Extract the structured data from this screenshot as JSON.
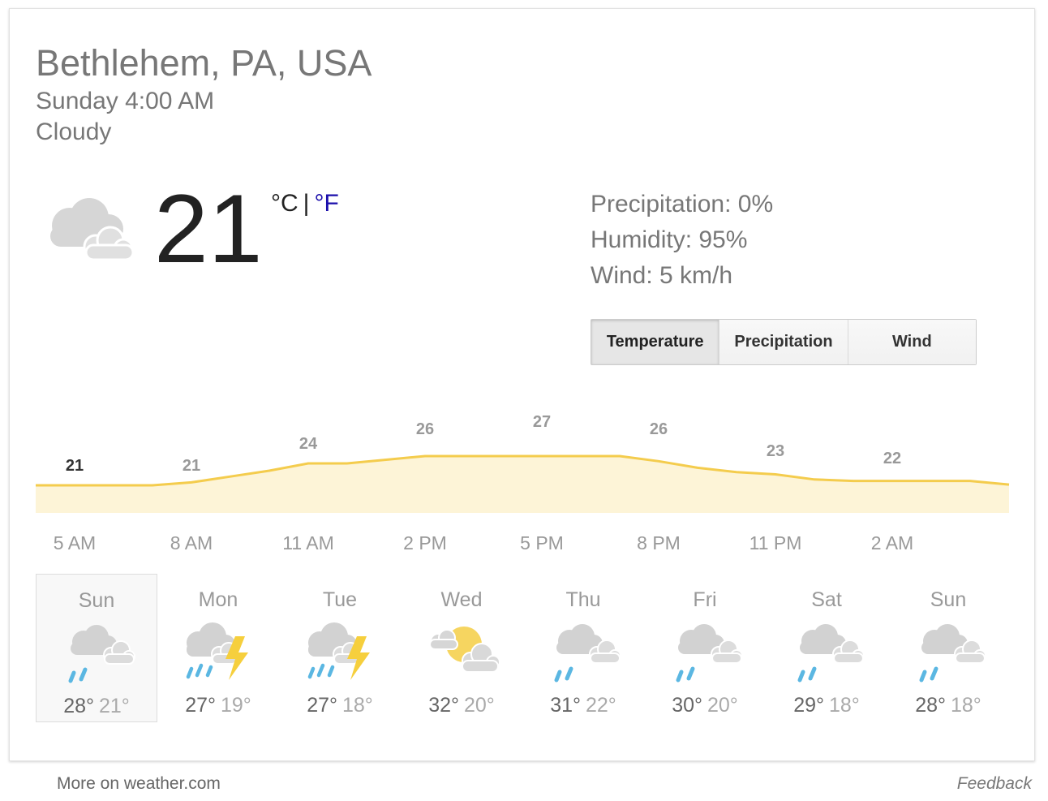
{
  "location": "Bethlehem, PA, USA",
  "datetime": "Sunday 4:00 AM",
  "condition": "Cloudy",
  "current": {
    "temperature": "21",
    "unit_c": "°C",
    "unit_sep": "|",
    "unit_f": "°F",
    "icon": "cloudy-icon"
  },
  "details": {
    "precipitation": "Precipitation: 0%",
    "humidity": "Humidity: 95%",
    "wind": "Wind: 5 km/h"
  },
  "tabs": [
    {
      "label": "Temperature",
      "active": true
    },
    {
      "label": "Precipitation",
      "active": false
    },
    {
      "label": "Wind",
      "active": false
    }
  ],
  "chart_data": {
    "type": "area",
    "x": [
      "5 AM",
      "8 AM",
      "11 AM",
      "2 PM",
      "5 PM",
      "8 PM",
      "11 PM",
      "2 AM"
    ],
    "label_values": [
      21,
      21,
      24,
      26,
      27,
      26,
      23,
      22
    ],
    "series": [
      {
        "values": [
          21,
          21,
          21,
          21,
          21.4,
          22.2,
          23,
          24,
          24,
          24.5,
          25,
          25,
          25,
          25,
          25,
          25,
          24.3,
          23.4,
          22.8,
          22.5,
          21.8,
          21.6,
          21.6,
          21.6,
          21.6,
          21.1
        ]
      }
    ],
    "colors": {
      "line": "#f4cc4d",
      "fill": "#fdf4d7",
      "first_label": "#333333",
      "label": "#999999"
    },
    "grid": false,
    "legend": "none"
  },
  "forecast": [
    {
      "day": "Sun",
      "high": "28°",
      "low": "21°",
      "icon": "rain-icon",
      "active": true
    },
    {
      "day": "Mon",
      "high": "27°",
      "low": "19°",
      "icon": "thunderstorm-icon",
      "active": false
    },
    {
      "day": "Tue",
      "high": "27°",
      "low": "18°",
      "icon": "thunderstorm-icon",
      "active": false
    },
    {
      "day": "Wed",
      "high": "32°",
      "low": "20°",
      "icon": "partly-cloudy-icon",
      "active": false
    },
    {
      "day": "Thu",
      "high": "31°",
      "low": "22°",
      "icon": "rain-icon",
      "active": false
    },
    {
      "day": "Fri",
      "high": "30°",
      "low": "20°",
      "icon": "rain-icon",
      "active": false
    },
    {
      "day": "Sat",
      "high": "29°",
      "low": "18°",
      "icon": "rain-icon",
      "active": false
    },
    {
      "day": "Sun",
      "high": "28°",
      "low": "18°",
      "icon": "rain-icon",
      "active": false
    }
  ],
  "footer": {
    "more_link": "More on weather.com",
    "feedback": "Feedback"
  }
}
